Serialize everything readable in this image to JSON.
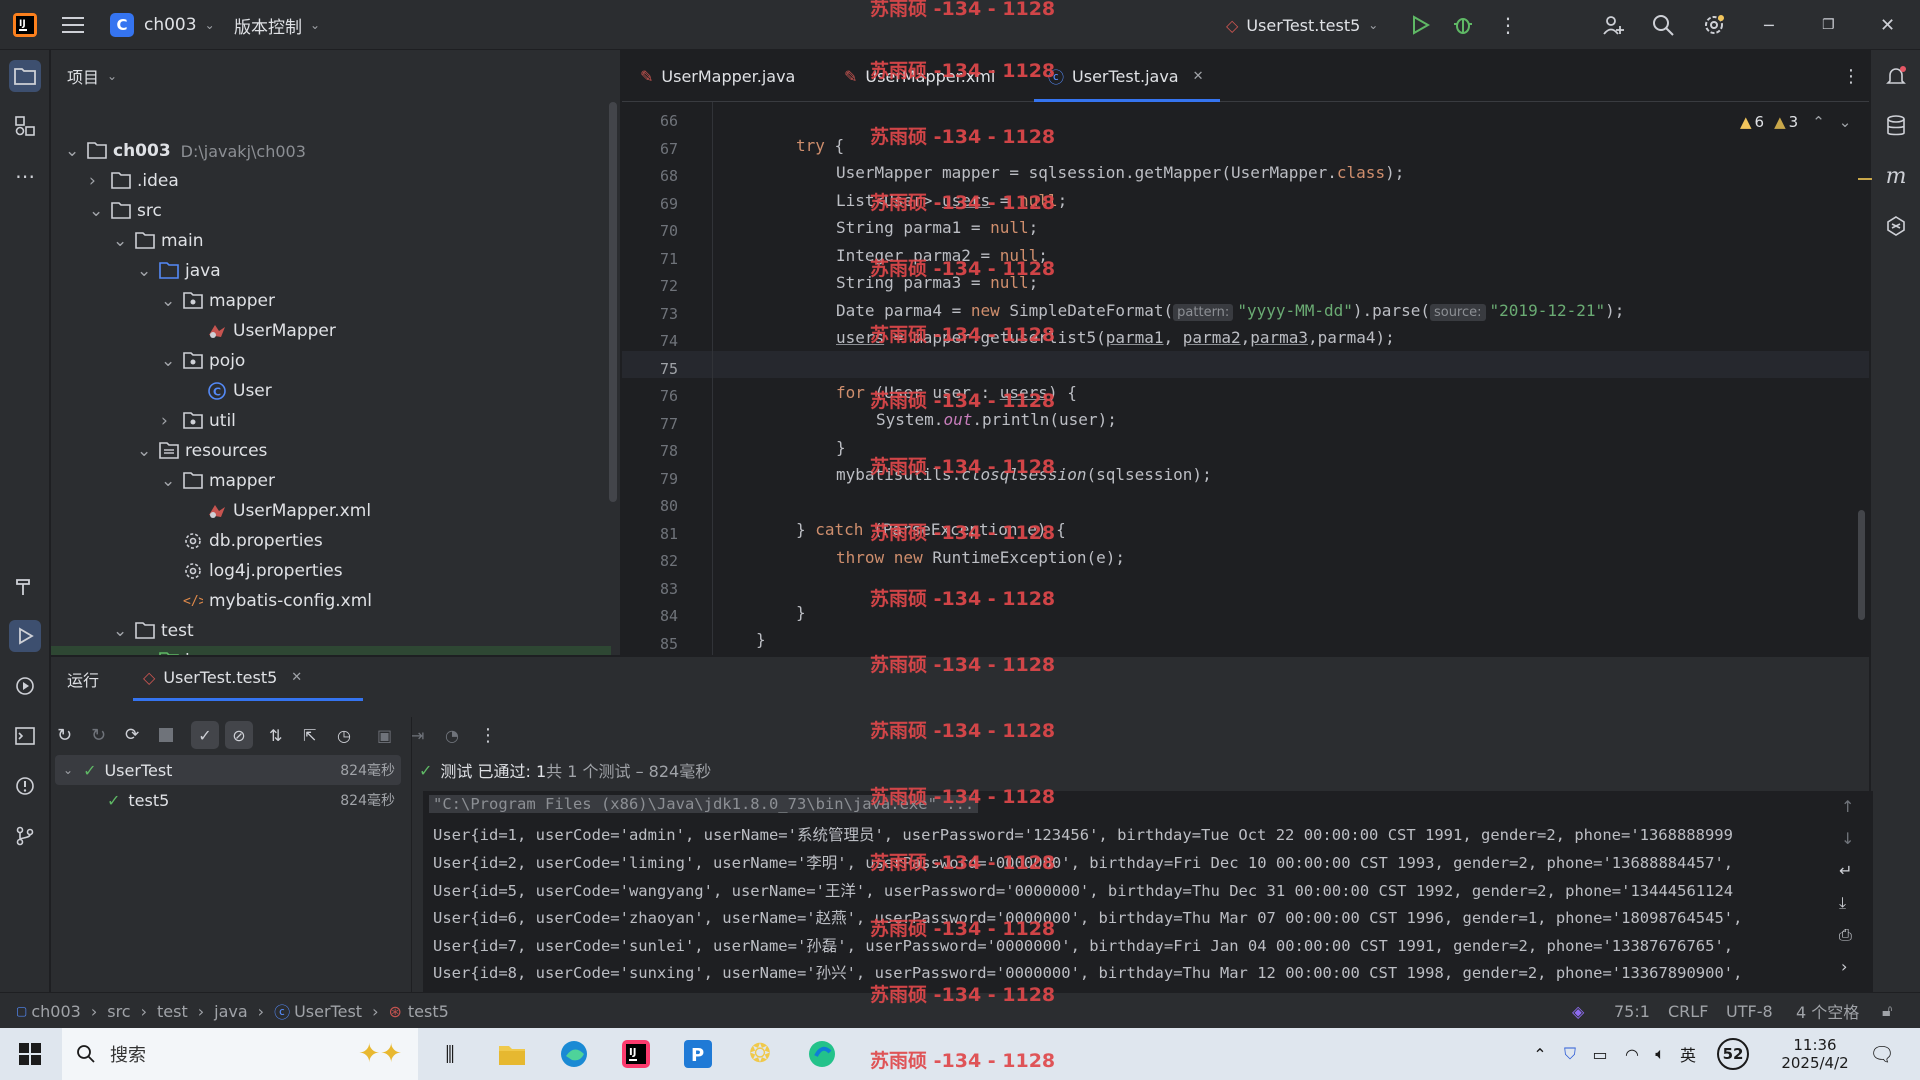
{
  "titlebar": {
    "project_badge": "C",
    "project_name": "ch003",
    "vcs_label": "版本控制",
    "run_config": "UserTest.test5"
  },
  "project_panel": {
    "title": "项目",
    "tree": [
      {
        "label": "ch003",
        "suffix": "D:\\javakj\\ch003",
        "icon": "folder-icon",
        "expanded": true
      },
      {
        "label": ".idea",
        "icon": "folder-icon",
        "expanded": false
      },
      {
        "label": "src",
        "icon": "folder-icon",
        "expanded": true
      },
      {
        "label": "main",
        "icon": "folder-icon",
        "expanded": true
      },
      {
        "label": "java",
        "icon": "source-folder-icon",
        "expanded": true
      },
      {
        "label": "mapper",
        "icon": "package-icon",
        "expanded": true
      },
      {
        "label": "UserMapper",
        "icon": "mybatis-icon"
      },
      {
        "label": "pojo",
        "icon": "package-icon",
        "expanded": true
      },
      {
        "label": "User",
        "icon": "class-icon"
      },
      {
        "label": "util",
        "icon": "package-icon",
        "expanded": false
      },
      {
        "label": "resources",
        "icon": "resources-folder-icon",
        "expanded": true
      },
      {
        "label": "mapper",
        "icon": "folder-icon",
        "expanded": true
      },
      {
        "label": "UserMapper.xml",
        "icon": "mybatis-icon"
      },
      {
        "label": "db.properties",
        "icon": "gear-icon"
      },
      {
        "label": "log4j.properties",
        "icon": "gear-icon"
      },
      {
        "label": "mybatis-config.xml",
        "icon": "xml-icon"
      },
      {
        "label": "test",
        "icon": "folder-icon",
        "expanded": true
      },
      {
        "label": "java",
        "icon": "test-folder-icon",
        "expanded": true
      }
    ]
  },
  "editor": {
    "tabs": [
      {
        "label": "UserMapper.java",
        "active": false
      },
      {
        "label": "UserMapper.xml",
        "active": false
      },
      {
        "label": "UserTest.java",
        "active": true
      }
    ],
    "warnings": "6",
    "weak_warnings": "3",
    "line_numbers": [
      "66",
      "67",
      "68",
      "69",
      "70",
      "71",
      "72",
      "73",
      "74",
      "75",
      "76",
      "77",
      "78",
      "79",
      "80",
      "81",
      "82",
      "83",
      "84",
      "85"
    ],
    "hint_pattern": "pattern:",
    "hint_source": "source:"
  },
  "run_panel": {
    "tab_title": "运行",
    "config_tab": "UserTest.test5",
    "tests": [
      {
        "name": "UserTest",
        "time": "824毫秒"
      },
      {
        "name": "test5",
        "time": "824毫秒"
      }
    ],
    "summary_prefix": "测试 已通过: 1",
    "summary_suffix": "共 1 个测试 – 824毫秒",
    "console": [
      "\"C:\\Program Files (x86)\\Java\\jdk1.8.0_73\\bin\\java.exe\" ...",
      "User{id=1, userCode='admin', userName='系统管理员', userPassword='123456', birthday=Tue Oct 22 00:00:00 CST 1991, gender=2, phone='1368888999",
      "User{id=2, userCode='liming', userName='李明', userPassword='0000000', birthday=Fri Dec 10 00:00:00 CST 1993, gender=2, phone='13688884457',",
      "User{id=5, userCode='wangyang', userName='王洋', userPassword='0000000', birthday=Thu Dec 31 00:00:00 CST 1992, gender=2, phone='13444561124",
      "User{id=6, userCode='zhaoyan', userName='赵燕', userPassword='0000000', birthday=Thu Mar 07 00:00:00 CST 1996, gender=1, phone='18098764545',",
      "User{id=7, userCode='sunlei', userName='孙磊', userPassword='0000000', birthday=Fri Jan 04 00:00:00 CST 1991, gender=2, phone='13387676765',",
      "User{id=8, userCode='sunxing', userName='孙兴', userPassword='0000000', birthday=Thu Mar 12 00:00:00 CST 1998, gender=2, phone='13367890900',"
    ]
  },
  "statusbar": {
    "breadcrumb": [
      "ch003",
      "src",
      "test",
      "java",
      "UserTest",
      "test5"
    ],
    "position": "75:1",
    "line_sep": "CRLF",
    "encoding": "UTF-8",
    "indent": "4 个空格"
  },
  "taskbar": {
    "search_placeholder": "搜索",
    "ime": "英",
    "badge": "52",
    "time": "11:36",
    "date": "2025/4/2"
  },
  "watermark": "苏雨硕 -134 - 1128",
  "colors": {
    "accent": "#3574f0",
    "pass": "#5fb865",
    "keyword": "#cf8e6d",
    "string": "#6aab73",
    "watermark": "#e0484b"
  }
}
